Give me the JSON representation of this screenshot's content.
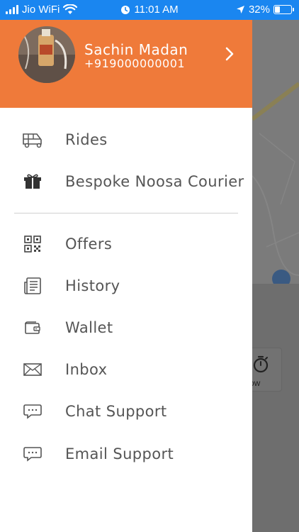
{
  "status_bar": {
    "carrier": "Jio WiFi",
    "time": "11:01 AM",
    "battery": "32%",
    "battery_level": 0.32
  },
  "drawer": {
    "user": {
      "name": "Sachin Madan",
      "phone": "+919000000001"
    },
    "menu_primary": [
      {
        "label": "Rides",
        "icon": "auto-rickshaw-icon"
      },
      {
        "label": "Bespoke Noosa Courier",
        "icon": "gift-box-icon"
      }
    ],
    "menu_secondary": [
      {
        "label": "Offers",
        "icon": "qr-code-icon"
      },
      {
        "label": "History",
        "icon": "history-list-icon"
      },
      {
        "label": "Wallet",
        "icon": "wallet-icon"
      },
      {
        "label": "Inbox",
        "icon": "envelope-icon"
      },
      {
        "label": "Chat Support",
        "icon": "chat-bubble-icon"
      },
      {
        "label": "Email Support",
        "icon": "chat-bubble-icon"
      }
    ]
  },
  "background": {
    "partial_label": "ow"
  },
  "colors": {
    "status_bar": "#1a86f0",
    "header": "#ef7a3a",
    "menu_text": "#555555",
    "overlay": "#7a7a7a"
  }
}
